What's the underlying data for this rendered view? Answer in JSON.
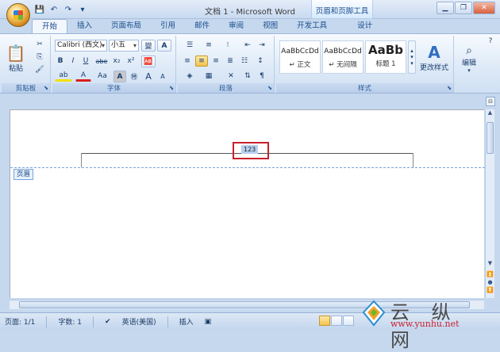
{
  "window": {
    "title": "文档 1 - Microsoft Word",
    "context_tab": "页眉和页脚工具"
  },
  "tabs": [
    "开始",
    "插入",
    "页面布局",
    "引用",
    "邮件",
    "审阅",
    "视图",
    "开发工具",
    "设计"
  ],
  "ribbon": {
    "clipboard": {
      "label": "剪贴板",
      "paste": "粘贴"
    },
    "font": {
      "label": "字体",
      "name": "Calibri (西文)",
      "size": "小五",
      "bold": "B",
      "italic": "I",
      "underline": "U",
      "strike": "abe",
      "sub": "x₂",
      "sup": "x²",
      "aa": "Aa",
      "grow": "A",
      "shrink": "A"
    },
    "paragraph": {
      "label": "段落"
    },
    "styles": {
      "label": "样式",
      "items": [
        {
          "preview": "AaBbCcDd",
          "name": "↵ 正文"
        },
        {
          "preview": "AaBbCcDd",
          "name": "↵ 无间隔"
        },
        {
          "preview": "AaBb",
          "name": "标题 1"
        }
      ],
      "change": "更改样式"
    },
    "edit": {
      "label": "编辑"
    }
  },
  "document": {
    "header_text": "123",
    "header_tag": "页眉"
  },
  "status": {
    "page": "页面: 1/1",
    "words": "字数: 1",
    "language": "英语(美国)",
    "mode": "插入"
  },
  "watermark": {
    "text": "云 纵 网",
    "url": "www.yunhu.net"
  }
}
